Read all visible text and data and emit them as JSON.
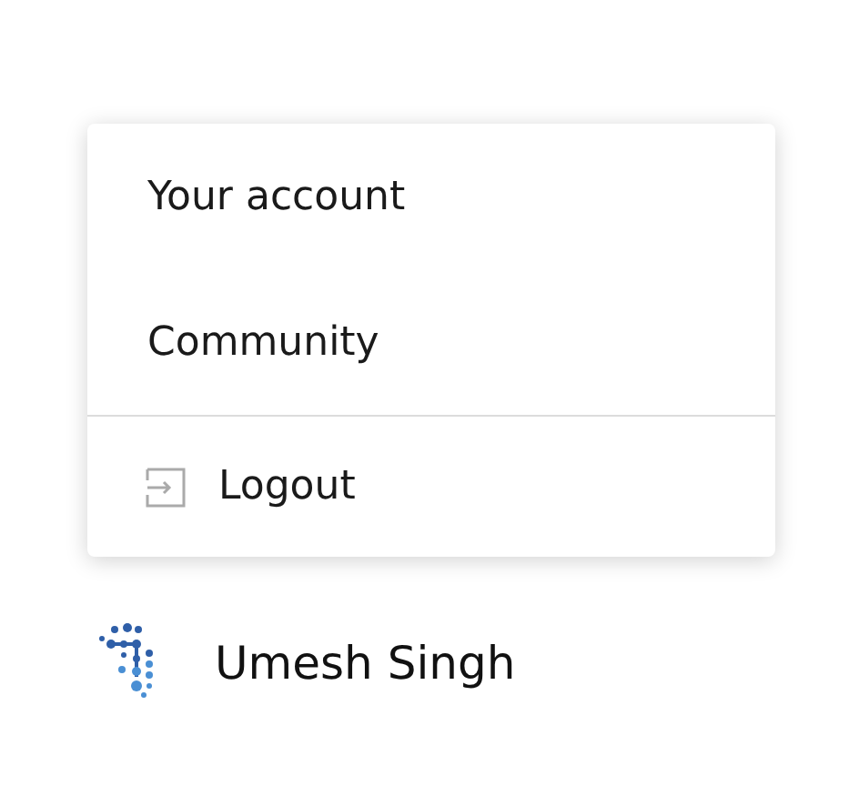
{
  "menu": {
    "items": [
      {
        "label": "Your account",
        "kind": "link"
      },
      {
        "label": "Community",
        "kind": "link"
      },
      {
        "label": "Logout",
        "kind": "logout"
      }
    ]
  },
  "user": {
    "name": "Umesh Singh"
  }
}
